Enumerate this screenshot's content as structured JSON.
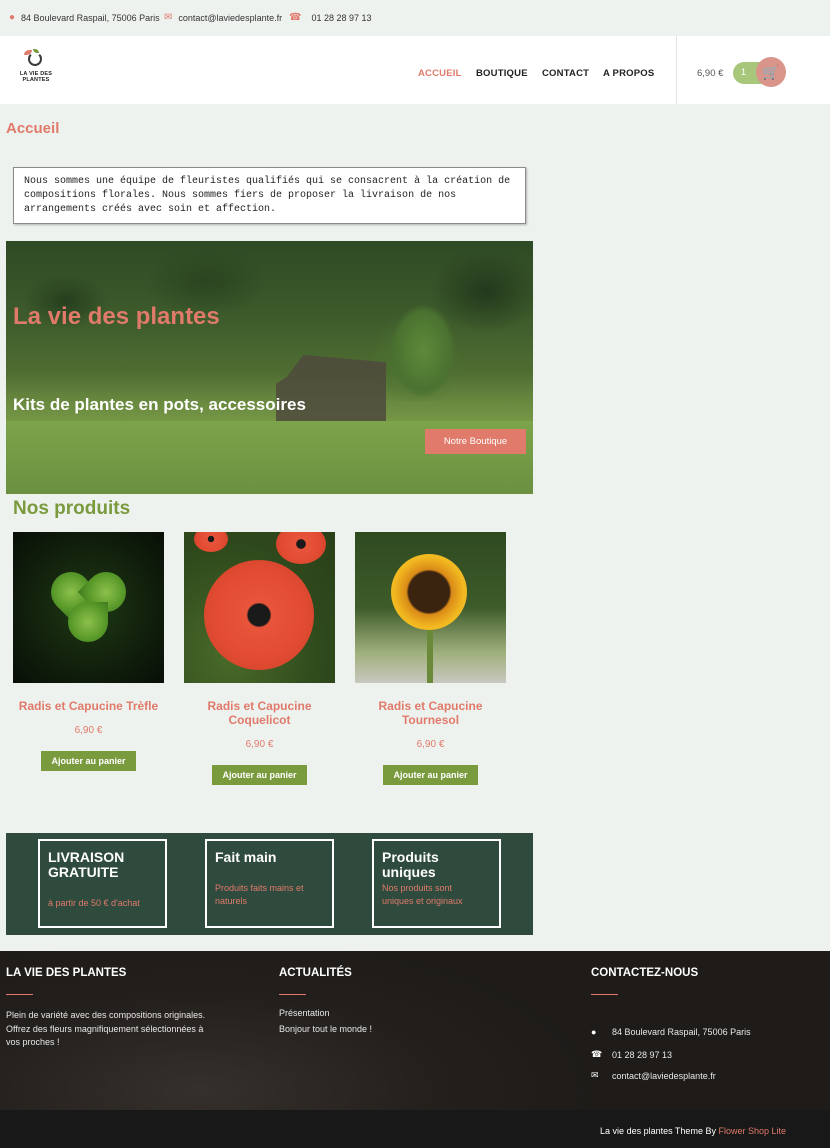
{
  "topbar": {
    "address": "84 Boulevard Raspail, 75006 Paris",
    "email": "contact@laviedesplante.fr",
    "phone": "01 28 28 97 13",
    "address_icon": "map-pin-icon",
    "email_icon": "envelope-icon",
    "phone_icon": "phone-icon"
  },
  "header": {
    "logo_text_line1": "LA VIE DES",
    "logo_text_line2": "PLANTES",
    "nav": [
      "ACCUEIL",
      "BOUTIQUE",
      "CONTACT",
      "A PROPOS"
    ],
    "active_nav": "ACCUEIL",
    "cart_total": "6,90 €",
    "cart_count": "1",
    "cart_icon": "shopping-cart-icon"
  },
  "page": {
    "title": "Accueil",
    "intro": "Nous sommes une équipe de fleuristes qualifiés qui se consacrent à la création de compositions florales. Nous sommes fiers de proposer la livraison de nos arrangements créés avec soin et affection."
  },
  "hero": {
    "title": "La vie des plantes",
    "subtitle": "Kits de plantes en pots, accessoires",
    "button": "Notre Boutique"
  },
  "products_section": {
    "title": "Nos produits",
    "items": [
      {
        "name": "Radis et Capucine Trèfle",
        "price": "6,90 €",
        "button": "Ajouter au panier"
      },
      {
        "name": "Radis et Capucine Coquelicot",
        "price": "6,90 €",
        "button": "Ajouter au panier"
      },
      {
        "name": "Radis et Capucine Tournesol",
        "price": "6,90 €",
        "button": "Ajouter au panier"
      }
    ]
  },
  "features": [
    {
      "title": "LIVRAISON GRATUITE",
      "desc": "à partir de 50 € d'achat"
    },
    {
      "title": "Fait main",
      "desc": "Produits faits mains et naturels"
    },
    {
      "title": "Produits uniques",
      "desc": "Nos produits sont uniques et originaux"
    }
  ],
  "footer": {
    "col1_title": "LA VIE DES PLANTES",
    "col1_text": "Plein de variété avec des compositions originales. Offrez des fleurs magnifiquement sélectionnées à vos proches !",
    "col2_title": "ACTUALITÉS",
    "col2_links": [
      "Présentation",
      "Bonjour tout le monde !"
    ],
    "col3_title": "CONTACTEZ-NOUS",
    "col3_address": "84 Boulevard Raspail, 75006 Paris",
    "col3_phone": "01 28 28 97 13",
    "col3_email": "contact@laviedesplante.fr",
    "credit_prefix": "La vie des plantes Theme By ",
    "credit_link": "Flower Shop Lite"
  },
  "colors": {
    "accent": "#e07a6a",
    "green": "#7a9a3e",
    "band": "#2f4b3e",
    "footer": "#231f1c"
  }
}
